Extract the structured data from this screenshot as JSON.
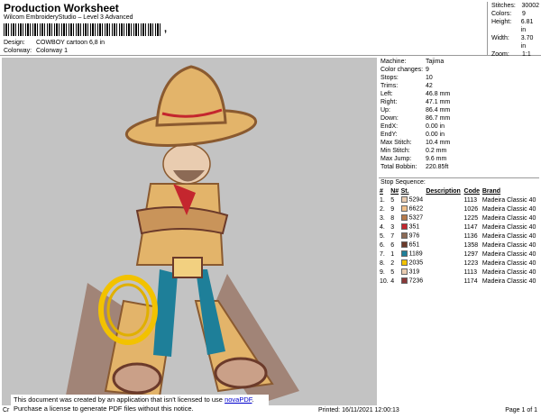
{
  "header": {
    "title": "Production Worksheet",
    "subtitle": "Wilcom EmbroideryStudio – Level 3 Advanced",
    "barcode_suffix": ",",
    "design_label": "Design:",
    "design_value": "COWBOY cartoon 6,8 in",
    "colorway_label": "Colorway:",
    "colorway_value": "Colorway 1"
  },
  "summary": [
    {
      "label": "Stitches:",
      "value": "30002"
    },
    {
      "label": "Colors:",
      "value": "9"
    },
    {
      "label": "Height:",
      "value": "6.81 in"
    },
    {
      "label": "Width:",
      "value": "3.70 in"
    },
    {
      "label": "Zoom:",
      "value": "1:1"
    }
  ],
  "machine_info": [
    {
      "label": "Machine:",
      "value": "Tajima"
    },
    {
      "label": "Color changes:",
      "value": "9"
    },
    {
      "label": "Stops:",
      "value": "10"
    },
    {
      "label": "Trims:",
      "value": "42"
    },
    {
      "label": "Left:",
      "value": "46.8 mm"
    },
    {
      "label": "Right:",
      "value": "47.1 mm"
    },
    {
      "label": "Up:",
      "value": "86.4 mm"
    },
    {
      "label": "Down:",
      "value": "86.7 mm"
    },
    {
      "label": "EndX:",
      "value": "0.00 in"
    },
    {
      "label": "EndY:",
      "value": "0.00 in"
    },
    {
      "label": "Max Stitch:",
      "value": "10.4 mm"
    },
    {
      "label": "Min Stitch:",
      "value": "0.2 mm"
    },
    {
      "label": "Max Jump:",
      "value": "9.6 mm"
    },
    {
      "label": "Total Bobbin:",
      "value": "220.85ft"
    }
  ],
  "stop_sequence": {
    "title": "Stop Sequence:",
    "columns": [
      "#",
      "N#",
      "St.",
      "Description",
      "Code",
      "Brand"
    ],
    "rows": [
      {
        "num": "1.",
        "n": "5",
        "color": "#e9ccb0",
        "st": "5294",
        "desc": "",
        "code": "1113",
        "brand": "Madeira Classic 40"
      },
      {
        "num": "2.",
        "n": "9",
        "color": "#f0c08a",
        "st": "6622",
        "desc": "",
        "code": "1026",
        "brand": "Madeira Classic 40"
      },
      {
        "num": "3.",
        "n": "8",
        "color": "#b67a4a",
        "st": "5327",
        "desc": "",
        "code": "1225",
        "brand": "Madeira Classic 40"
      },
      {
        "num": "4.",
        "n": "3",
        "color": "#c4262e",
        "st": "351",
        "desc": "",
        "code": "1147",
        "brand": "Madeira Classic 40"
      },
      {
        "num": "5.",
        "n": "7",
        "color": "#8c6a55",
        "st": "976",
        "desc": "",
        "code": "1136",
        "brand": "Madeira Classic 40"
      },
      {
        "num": "6.",
        "n": "6",
        "color": "#6b3a2a",
        "st": "651",
        "desc": "",
        "code": "1358",
        "brand": "Madeira Classic 40"
      },
      {
        "num": "7.",
        "n": "1",
        "color": "#1e7f99",
        "st": "1189",
        "desc": "",
        "code": "1297",
        "brand": "Madeira Classic 40"
      },
      {
        "num": "8.",
        "n": "2",
        "color": "#f2c200",
        "st": "2035",
        "desc": "",
        "code": "1223",
        "brand": "Madeira Classic 40"
      },
      {
        "num": "9.",
        "n": "5",
        "color": "#e9ccb0",
        "st": "319",
        "desc": "",
        "code": "1113",
        "brand": "Madeira Classic 40"
      },
      {
        "num": "10.",
        "n": "4",
        "color": "#8a3a3a",
        "st": "7236",
        "desc": "",
        "code": "1174",
        "brand": "Madeira Classic 40"
      }
    ]
  },
  "notice": {
    "line1_pre": "This document was created by an application that isn't licensed to use ",
    "link": "novaPDF",
    "line1_post": ".",
    "line2": "Purchase a license to generate PDF files without this notice."
  },
  "footer": {
    "left": "Cr",
    "printed": "Printed: 16/11/2021 12:00:13",
    "page": "Page 1 of 1"
  }
}
